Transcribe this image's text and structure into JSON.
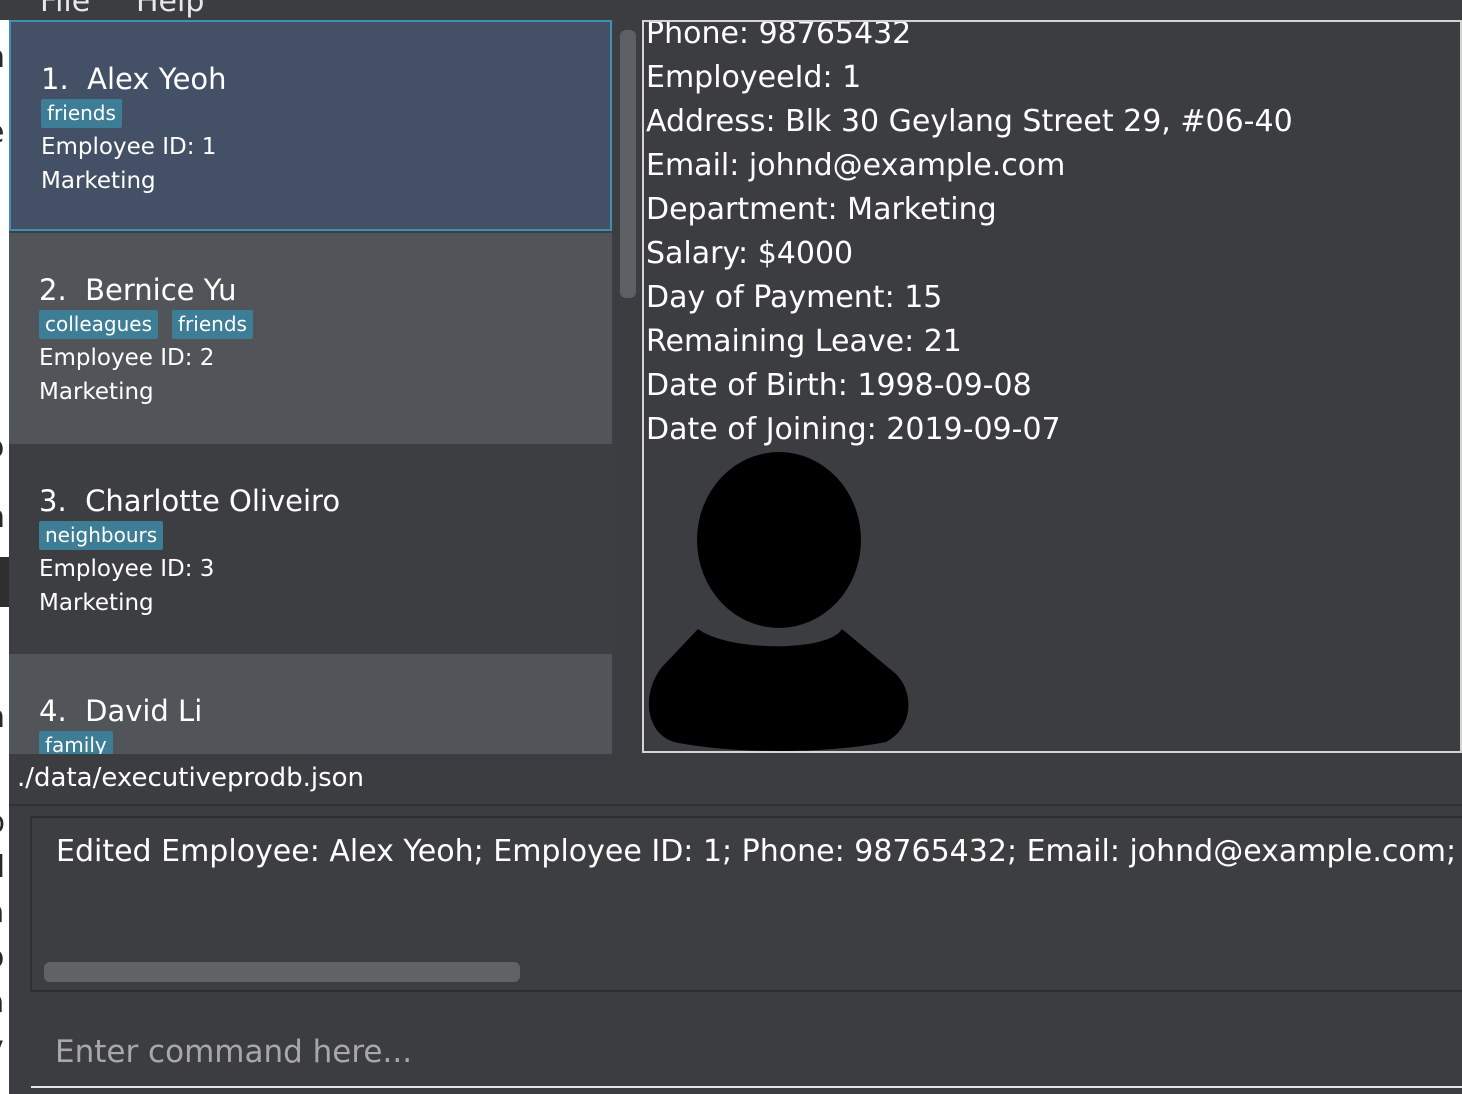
{
  "menu": {
    "file": "File",
    "help": "Help"
  },
  "employees": [
    {
      "index": "1.",
      "name": "Alex Yeoh",
      "tags": [
        "friends"
      ],
      "employee_id": "Employee ID: 1",
      "department": "Marketing"
    },
    {
      "index": "2.",
      "name": "Bernice Yu",
      "tags": [
        "colleagues",
        "friends"
      ],
      "employee_id": "Employee ID: 2",
      "department": "Marketing"
    },
    {
      "index": "3.",
      "name": "Charlotte Oliveiro",
      "tags": [
        "neighbours"
      ],
      "employee_id": "Employee ID: 3",
      "department": "Marketing"
    },
    {
      "index": "4.",
      "name": "David Li",
      "tags": [
        "family"
      ],
      "employee_id": "",
      "department": ""
    }
  ],
  "details": {
    "phone": "Phone: 98765432",
    "employee_id": "EmployeeId: 1",
    "address": "Address: Blk 30 Geylang Street 29, #06-40",
    "email": "Email: johnd@example.com",
    "department": "Department: Marketing",
    "salary": "Salary: $4000",
    "payment_day": "Day of Payment: 15",
    "leave": "Remaining Leave: 21",
    "dob": "Date of Birth: 1998-09-08",
    "doj": "Date of Joining: 2019-09-07",
    "photo_icon": "user-silhouette-icon"
  },
  "status_bar": {
    "file_path": "./data/executiveprodb.json"
  },
  "result": {
    "message": "Edited Employee: Alex Yeoh; Employee ID: 1; Phone: 98765432; Email: johnd@example.com; Add"
  },
  "command": {
    "placeholder": "Enter command here...",
    "value": ""
  },
  "background_glyphs": [
    "n",
    "e",
    "o",
    "n",
    "n",
    "p",
    "d",
    "a",
    "o",
    "a",
    "y"
  ]
}
